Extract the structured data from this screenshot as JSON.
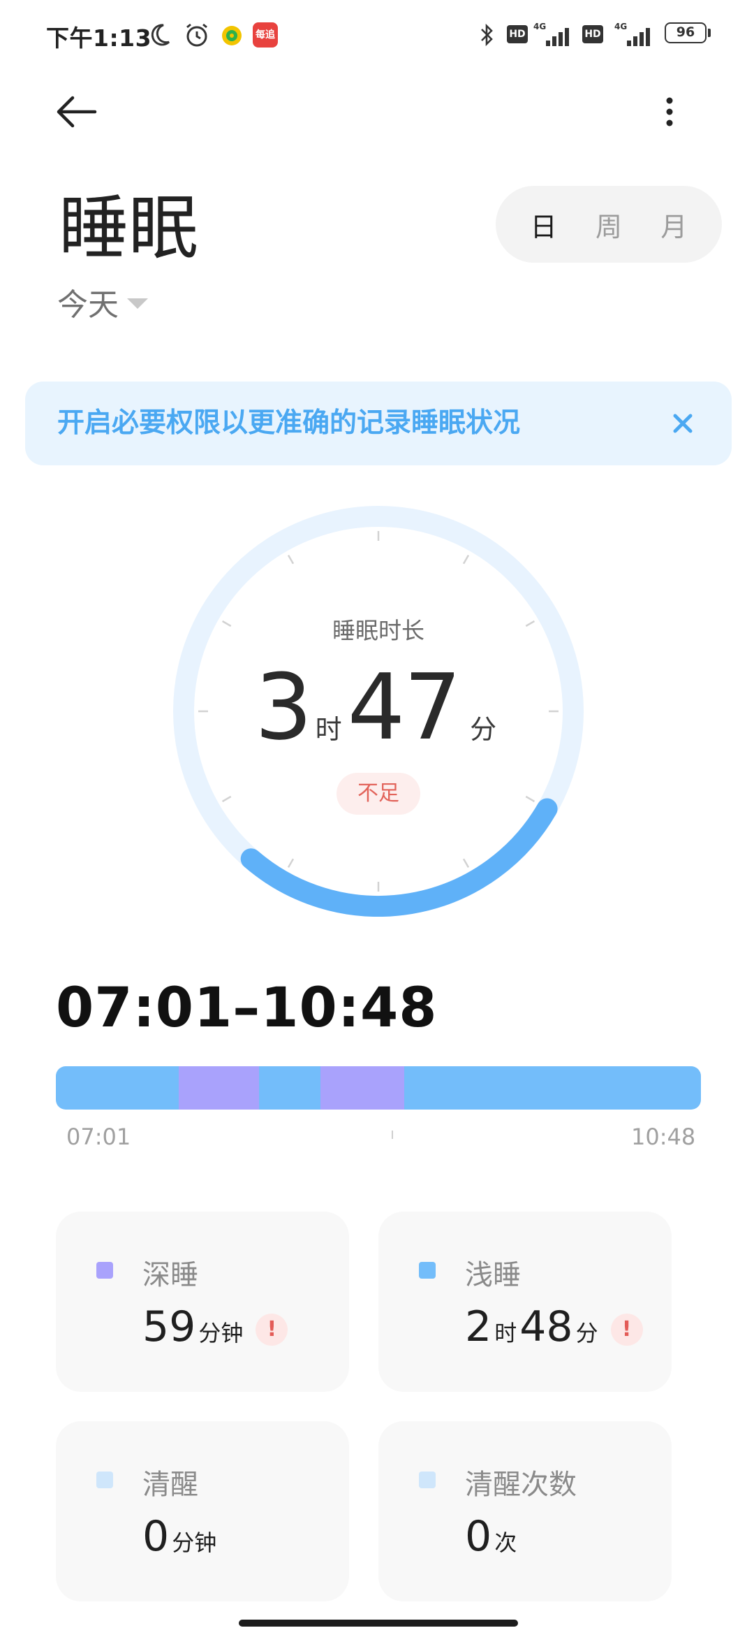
{
  "status_bar": {
    "time": "下午1:13",
    "battery": "96",
    "network_label": "4G",
    "hd_label": "HD",
    "app_badge": "每追"
  },
  "header": {
    "title": "睡眠",
    "date_selector": "今天"
  },
  "period_tabs": [
    {
      "label": "日",
      "active": true
    },
    {
      "label": "周",
      "active": false
    },
    {
      "label": "月",
      "active": false
    }
  ],
  "permission_banner": {
    "text": "开启必要权限以更准确的记录睡眠状况"
  },
  "summary": {
    "label": "睡眠时长",
    "hours": "3",
    "hours_unit": "时",
    "minutes": "47",
    "minutes_unit": "分",
    "status": "不足",
    "ring_progress": 0.28
  },
  "timeline": {
    "range": "07:01–10:48",
    "start": "07:01",
    "end": "10:48",
    "segments": [
      {
        "stage": "light",
        "fraction": 0.19
      },
      {
        "stage": "deep",
        "fraction": 0.125
      },
      {
        "stage": "light",
        "fraction": 0.095
      },
      {
        "stage": "deep",
        "fraction": 0.13
      },
      {
        "stage": "light",
        "fraction": 0.46
      }
    ]
  },
  "colors": {
    "deep": "#a9a2fc",
    "light": "#73bdfa",
    "awake": "#cfe6fb",
    "ring_track": "#e8f3fe",
    "ring_progress": "#5fb1f8",
    "accent_text": "#4aa8f2",
    "warning": "#e35b57"
  },
  "stats": {
    "deep": {
      "title": "深睡",
      "parts": [
        {
          "num": "59",
          "unit": "分钟"
        }
      ],
      "warning": true,
      "swatch": "#a9a2fc"
    },
    "light": {
      "title": "浅睡",
      "parts": [
        {
          "num": "2",
          "unit": "时"
        },
        {
          "num": "48",
          "unit": "分"
        }
      ],
      "warning": true,
      "swatch": "#73bdfa"
    },
    "awake": {
      "title": "清醒",
      "parts": [
        {
          "num": "0",
          "unit": "分钟"
        }
      ],
      "warning": false,
      "swatch": "#cfe6fb"
    },
    "awake_count": {
      "title": "清醒次数",
      "parts": [
        {
          "num": "0",
          "unit": "次"
        }
      ],
      "warning": false,
      "swatch": "#cfe6fb"
    }
  },
  "icons": {
    "back": "arrow-left-icon",
    "more": "more-vertical-icon",
    "close": "close-icon",
    "warning": "exclamation-icon",
    "dropdown": "caret-down-icon"
  }
}
